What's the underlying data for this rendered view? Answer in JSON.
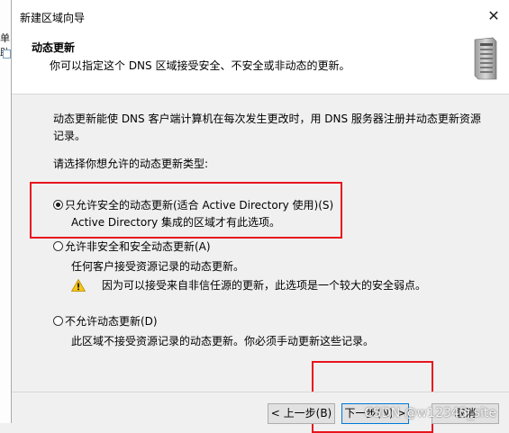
{
  "background": {
    "window_fragment_text": "单助"
  },
  "dialog": {
    "title": "新建区域向导",
    "close_glyph": "✕"
  },
  "header": {
    "title": "动态更新",
    "subtitle": "你可以指定这个 DNS 区域接受安全、不安全或非动态的更新。",
    "icon": "server-icon"
  },
  "content": {
    "intro": "动态更新能使 DNS 客户端计算机在每次发生更改时，用 DNS 服务器注册并动态更新资源记录。",
    "choose_prompt": "请选择你想允许的动态更新类型:",
    "options": [
      {
        "label": "只允许安全的动态更新(适合 Active Directory 使用)(S)",
        "description": "Active Directory 集成的区域才有此选项。",
        "selected": true
      },
      {
        "label": "允许非安全和安全动态更新(A)",
        "description": "任何客户接受资源记录的动态更新。",
        "warning": "因为可以接受来自非信任源的更新，此选项是一个较大的安全弱点。",
        "selected": false
      },
      {
        "label": "不允许动态更新(D)",
        "description": "此区域不接受资源记录的动态更新。你必须手动更新这些记录。",
        "selected": false
      }
    ]
  },
  "footer": {
    "back_label": "< 上一步(B)",
    "next_label": "下一步(N) >",
    "cancel_label": "取消"
  },
  "annotations": {
    "highlight_color": "#e8141e"
  },
  "watermark": "CSDN @w12345_site"
}
